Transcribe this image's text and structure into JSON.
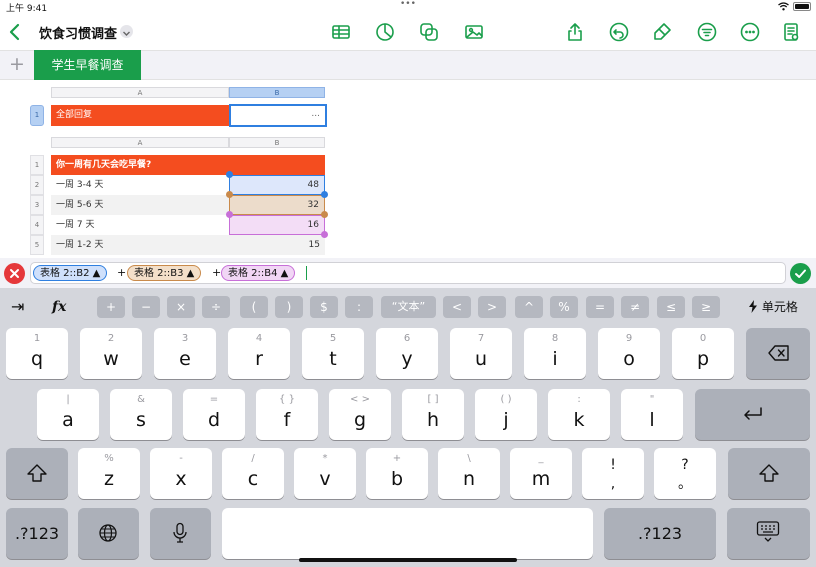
{
  "status": {
    "time": "上午 9:41",
    "dots": "•••"
  },
  "toolbar": {
    "title": "饮食习惯调查"
  },
  "tabs": {
    "add": "+",
    "active": "学生早餐调查"
  },
  "table1": {
    "col_a": "A",
    "col_b": "B",
    "row_num": "1",
    "a1": "全部回复",
    "b1": "..."
  },
  "table2": {
    "col_a": "A",
    "col_b": "B",
    "header": {
      "num": "1",
      "text": "你一周有几天会吃早餐?"
    },
    "rows": [
      {
        "num": "2",
        "label": "一周 3-4 天",
        "value": "48"
      },
      {
        "num": "3",
        "label": "一周 5-6 天",
        "value": "32"
      },
      {
        "num": "4",
        "label": "一周 7 天",
        "value": "16"
      },
      {
        "num": "5",
        "label": "一周 1-2 天",
        "value": "15"
      }
    ]
  },
  "formula": {
    "tokens": [
      {
        "text": "表格 2::B2 ▲"
      },
      {
        "text": "表格 2::B3 ▲"
      },
      {
        "text": "表格 2::B4 ▲"
      }
    ],
    "plus": "+"
  },
  "symbol_bar": {
    "tab_key": "⇥",
    "fx": "fx",
    "symbols": [
      "+",
      "−",
      "×",
      "÷",
      "(",
      ")",
      "$",
      ":",
      "“文本”",
      "<",
      ">",
      "^",
      "%",
      "=",
      "≠",
      "≤",
      "≥"
    ],
    "cell_label": "单元格"
  },
  "keyboard": {
    "row1": [
      {
        "sub": "1",
        "main": "q"
      },
      {
        "sub": "2",
        "main": "w"
      },
      {
        "sub": "3",
        "main": "e"
      },
      {
        "sub": "4",
        "main": "r"
      },
      {
        "sub": "5",
        "main": "t"
      },
      {
        "sub": "6",
        "main": "y"
      },
      {
        "sub": "7",
        "main": "u"
      },
      {
        "sub": "8",
        "main": "i"
      },
      {
        "sub": "9",
        "main": "o"
      },
      {
        "sub": "0",
        "main": "p"
      }
    ],
    "row2": [
      {
        "sub": "|",
        "main": "a"
      },
      {
        "sub": "&",
        "main": "s"
      },
      {
        "sub": "=",
        "main": "d"
      },
      {
        "sub": "{ }",
        "main": "f"
      },
      {
        "sub": "< >",
        "main": "g"
      },
      {
        "sub": "[ ]",
        "main": "h"
      },
      {
        "sub": "( )",
        "main": "j"
      },
      {
        "sub": ":",
        "main": "k"
      },
      {
        "sub": "\"",
        "main": "l"
      }
    ],
    "row3": [
      {
        "sub": "%",
        "main": "z"
      },
      {
        "sub": "-",
        "main": "x"
      },
      {
        "sub": "/",
        "main": "c"
      },
      {
        "sub": "*",
        "main": "v"
      },
      {
        "sub": "+",
        "main": "b"
      },
      {
        "sub": "\\",
        "main": "n"
      },
      {
        "sub": "_",
        "main": "m"
      },
      {
        "sub": "!",
        "main": ","
      },
      {
        "sub": "?",
        "main": "。"
      }
    ],
    "num_label": ".?123"
  },
  "colors": {
    "accent": "#1a9e4b",
    "orange": "#f44d1f",
    "blue": "#2f7fe0",
    "brown": "#c98a4b",
    "purple": "#c76fd8"
  }
}
